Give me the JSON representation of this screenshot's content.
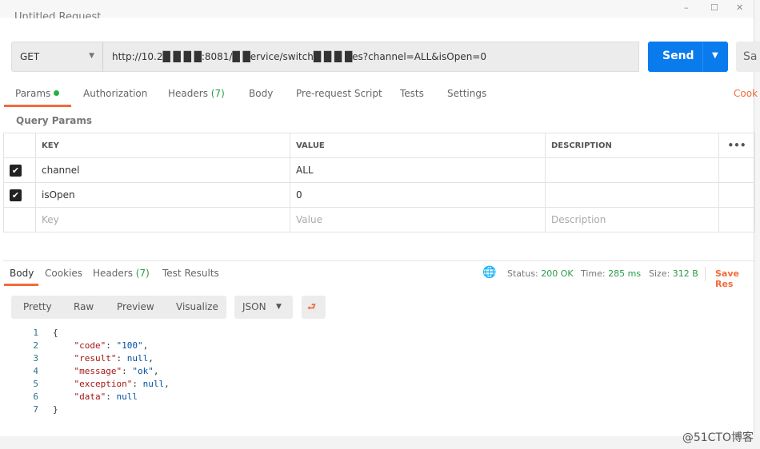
{
  "window": {
    "title": "Untitled Request",
    "controls": [
      "–",
      "☐",
      "✕"
    ]
  },
  "request": {
    "method": "GET",
    "url": "http://10.2█ █ █ █:8081/█ █ervice/switch█ █ █ █es?channel=ALL&isOpen=0",
    "send_label": "Send",
    "save_label": "Sa"
  },
  "tabs": [
    {
      "label": "Params"
    },
    {
      "label": "Authorization"
    },
    {
      "label": "Headers",
      "count": "(7)"
    },
    {
      "label": "Body"
    },
    {
      "label": "Pre-request Script"
    },
    {
      "label": "Tests"
    },
    {
      "label": "Settings"
    }
  ],
  "cookies_link": "Cook",
  "query_params": {
    "title": "Query Params",
    "headers": [
      "KEY",
      "VALUE",
      "DESCRIPTION"
    ],
    "more": "•••",
    "rows": [
      {
        "checked": true,
        "key": "channel",
        "value": "ALL",
        "description": ""
      },
      {
        "checked": true,
        "key": "isOpen",
        "value": "0",
        "description": ""
      }
    ],
    "placeholder": {
      "key": "Key",
      "value": "Value",
      "description": "Description"
    }
  },
  "response": {
    "tabs": [
      {
        "label": "Body"
      },
      {
        "label": "Cookies"
      },
      {
        "label": "Headers",
        "count": "(7)"
      },
      {
        "label": "Test Results"
      }
    ],
    "status_label": "Status:",
    "status": "200 OK",
    "time_label": "Time:",
    "time": "285 ms",
    "size_label": "Size:",
    "size": "312 B",
    "save": "Save Res",
    "views": [
      "Pretty",
      "Raw",
      "Preview",
      "Visualize"
    ],
    "format": "JSON",
    "lines": [
      [
        "1",
        "{"
      ],
      [
        "2",
        "\"code\"",
        ": ",
        "\"100\"",
        ","
      ],
      [
        "3",
        "\"result\"",
        ": ",
        "null",
        ","
      ],
      [
        "4",
        "\"message\"",
        ": ",
        "\"ok\"",
        ","
      ],
      [
        "5",
        "\"exception\"",
        ": ",
        "null",
        ","
      ],
      [
        "6",
        "\"data\"",
        ": ",
        "null",
        ""
      ],
      [
        "7",
        "}"
      ]
    ]
  },
  "watermark": "@51CTO博客",
  "colors": {
    "accent": "#f26b3a",
    "send": "#097bed",
    "status": "#2a9d47"
  }
}
